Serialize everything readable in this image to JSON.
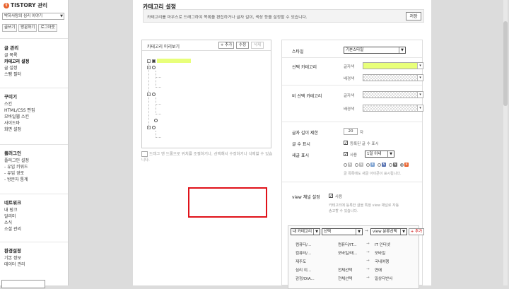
{
  "sidebar": {
    "logo": "TISTORY 관리",
    "blog_selector": "박하사탕의 심리 이야기",
    "quick_links": [
      "글쓰기",
      "방문하기",
      "로그아웃"
    ],
    "groups": [
      {
        "title": "글 관리",
        "items": [
          "글 목록",
          "카테고리 설정",
          "글 설정",
          "스팸 필터"
        ]
      },
      {
        "title": "꾸미기",
        "items": [
          "스킨",
          "HTML/CSS 편집",
          "모바일웹 스킨",
          "사이드바",
          "화면 설정"
        ]
      },
      {
        "title": "플러그인",
        "items": [
          "플러그인 설정",
          "- 유입 키워드",
          "- 유입 경로",
          "- 방문자 통계"
        ]
      },
      {
        "title": "네트워크",
        "items": [
          "내 링크",
          "알리미",
          "소식",
          "소셜 관리"
        ]
      },
      {
        "title": "환경설정",
        "items": [
          "기본 정보",
          "데이터 관리"
        ]
      }
    ]
  },
  "main": {
    "title": "카테고리 설정",
    "description": "카테고리를 마우스로 드래그하여 목록을 편집하거나 글자 길이, 색상 등을 설정할 수 있습니다.",
    "save": "저장"
  },
  "preview": {
    "label": "카테고리 미리보기",
    "add": "+ 추가",
    "edit": "수정",
    "delete": "삭제",
    "hint": "드래그 앤 드롭으로 위치를 조절하거나, 선택해서 수정하거나 삭제할 수 있습니다."
  },
  "settings": {
    "style_label": "스타일",
    "style_value": "기본스타일",
    "selected_label": "선택 카테고리",
    "unselected_label": "비 선택 카테고리",
    "text_color_label": "글자색",
    "bg_color_label": "배경색",
    "selected_text_color": "#e8ff7a",
    "length_label": "글자 길이 제한",
    "length_value": "20",
    "length_unit": "자",
    "count_label": "글 수 표시",
    "count_option": "등록된 글 수 표시",
    "new_label": "새글 표시",
    "new_use": "사용",
    "new_period": "1일 이내",
    "new_hint": "글 목록에도 새글 아이콘이 표시됩니다.",
    "view_label": "view 채널 설정",
    "view_use": "사용",
    "view_hint": "카테고리에 등록한 글을 특정 view 채널로 자동 송고할 수 있습니다."
  },
  "channel": {
    "my_category": "내 카테고리",
    "select": "선택",
    "view_category": "view 분류선택",
    "add": "+ 추가",
    "mappings": [
      {
        "from": "컴퓨터/...",
        "mid": "컴퓨터/IT...",
        "to": "IT 인터넷"
      },
      {
        "from": "컴퓨터/...",
        "mid": "모바일/태...",
        "to": "모바일"
      },
      {
        "from": "제주도",
        "mid": "",
        "to": "국내여행"
      },
      {
        "from": "심리 이...",
        "mid": "전체선택",
        "to": "연애"
      },
      {
        "from": "감정/DIA...",
        "mid": "전체선택",
        "to": "일상다반사"
      }
    ]
  }
}
